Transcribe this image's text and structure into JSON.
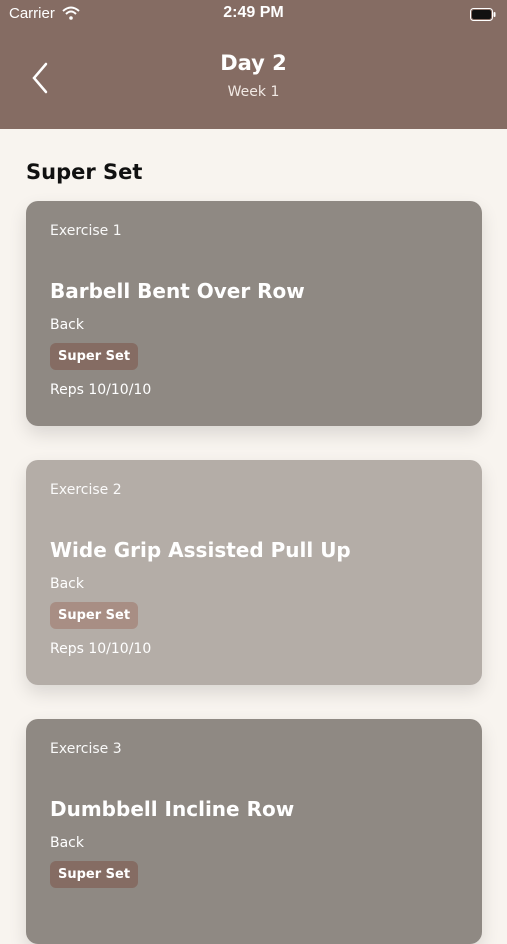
{
  "status": {
    "carrier": "Carrier",
    "time": "2:49 PM"
  },
  "header": {
    "title": "Day 2",
    "subtitle": "Week 1"
  },
  "section": {
    "title": "Super Set"
  },
  "exercises": [
    {
      "number": "Exercise 1",
      "name": "Barbell Bent Over Row",
      "body_part": "Back",
      "badge": "Super Set",
      "reps": "Reps 10/10/10"
    },
    {
      "number": "Exercise 2",
      "name": "Wide Grip Assisted Pull Up",
      "body_part": "Back",
      "badge": "Super Set",
      "reps": "Reps 10/10/10"
    },
    {
      "number": "Exercise 3",
      "name": "Dumbbell Incline Row",
      "body_part": "Back",
      "badge": "Super Set",
      "reps": ""
    }
  ],
  "colors": {
    "header": "#856c63",
    "card_dark": "#8f8983",
    "card_light": "#b4ada7",
    "background": "#f8f4ef"
  }
}
